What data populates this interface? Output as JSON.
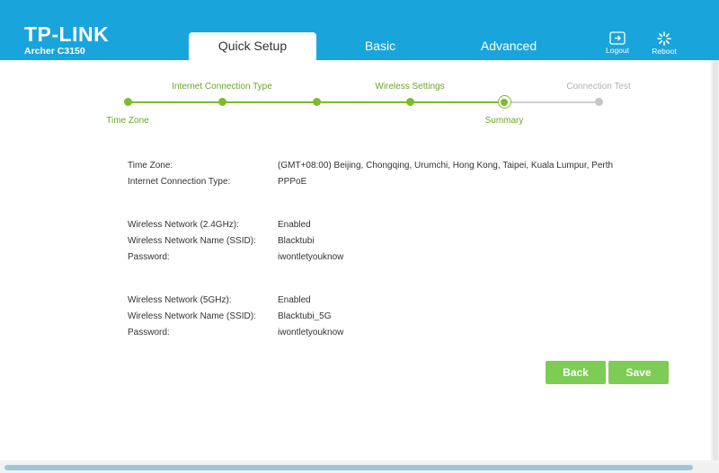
{
  "header": {
    "brand": "TP-LINK",
    "model": "Archer C3150",
    "tabs": [
      {
        "label": "Quick Setup",
        "active": true
      },
      {
        "label": "Basic",
        "active": false
      },
      {
        "label": "Advanced",
        "active": false
      }
    ],
    "logout": {
      "label": "Logout",
      "icon": "logout-icon"
    },
    "reboot": {
      "label": "Reboot",
      "icon": "reboot-icon"
    }
  },
  "stepper": {
    "steps": [
      {
        "label": "Time Zone",
        "state": "done"
      },
      {
        "label": "Internet Connection Type",
        "state": "done"
      },
      {
        "label": "",
        "state": "done"
      },
      {
        "label": "Wireless Settings",
        "state": "done"
      },
      {
        "label": "Summary",
        "state": "current"
      },
      {
        "label": "Connection Test",
        "state": "todo"
      }
    ]
  },
  "summary": {
    "general": [
      {
        "label": "Time Zone:",
        "value": "(GMT+08:00) Beijing, Chongqing, Urumchi, Hong Kong, Taipei, Kuala Lumpur, Perth"
      },
      {
        "label": "Internet Connection Type:",
        "value": "PPPoE"
      }
    ],
    "wireless_24": [
      {
        "label": "Wireless Network (2.4GHz):",
        "value": "Enabled"
      },
      {
        "label": "Wireless Network Name (SSID):",
        "value": "Blacktubi"
      },
      {
        "label": "Password:",
        "value": "iwontletyouknow"
      }
    ],
    "wireless_5": [
      {
        "label": "Wireless Network (5GHz):",
        "value": "Enabled"
      },
      {
        "label": "Wireless Network Name (SSID):",
        "value": "Blacktubi_5G"
      },
      {
        "label": "Password:",
        "value": "iwontletyouknow"
      }
    ]
  },
  "buttons": {
    "back": "Back",
    "save": "Save"
  },
  "colors": {
    "header_bg": "#1aa4dc",
    "accent_green": "#7cbb2e",
    "button_green": "#7ccc55"
  }
}
